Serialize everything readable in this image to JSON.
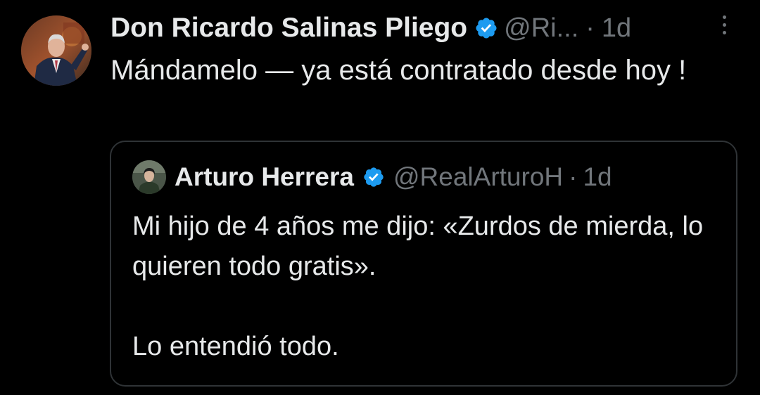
{
  "tweet": {
    "author_name": "Don Ricardo Salinas Pliego",
    "handle": "@Ri...",
    "separator": "·",
    "time": "1d",
    "text": "Mándamelo — ya está contratado desde hoy !"
  },
  "quote": {
    "author_name": "Arturo Herrera",
    "handle": "@RealArturoH",
    "separator": "·",
    "time": "1d",
    "paragraphs": [
      "Mi hijo de 4 años me dijo: «Zurdos de mierda, lo quieren todo gratis».",
      "Lo entendió todo."
    ]
  },
  "icons": {
    "verified": "verified-badge-icon",
    "more": "more-options-icon"
  },
  "colors": {
    "background": "#000000",
    "text": "#e7e9ea",
    "secondary": "#71767b",
    "verified": "#1d9bf0",
    "border": "#2f3336"
  }
}
